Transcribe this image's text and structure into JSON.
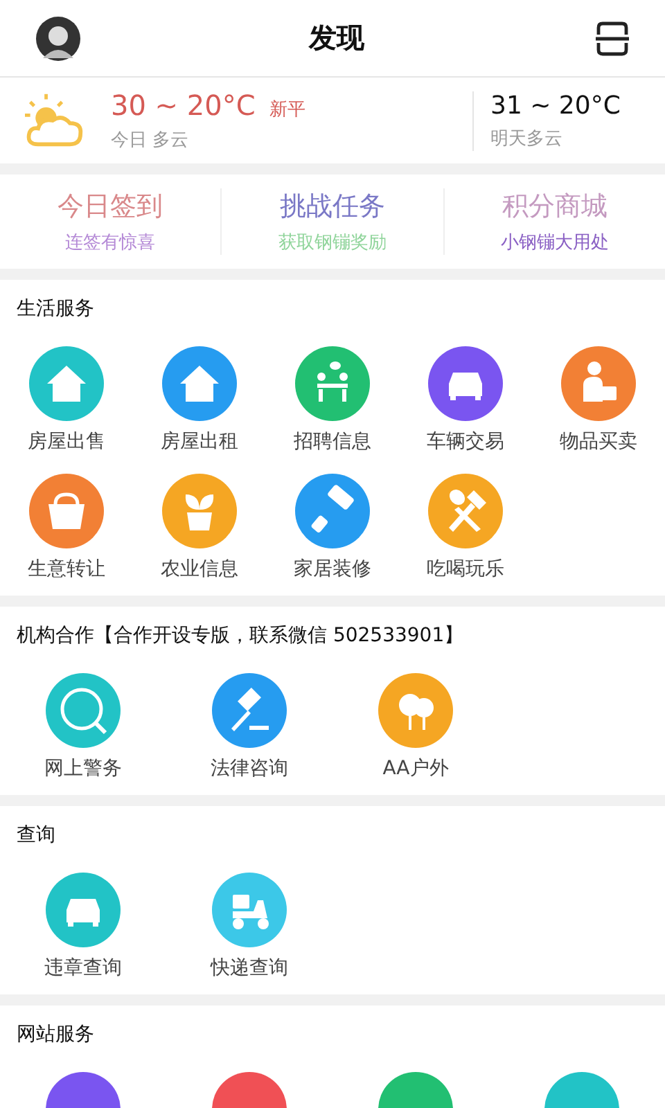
{
  "header": {
    "title": "发现"
  },
  "weather": {
    "today": {
      "temp": "30 ~ 20°C",
      "city": "新平",
      "desc": "今日 多云"
    },
    "tomorrow": {
      "temp": "31 ~ 20°C",
      "desc": "明天多云"
    }
  },
  "quick_links": [
    {
      "title": "今日签到",
      "color": "#d9888a",
      "subtitle": {
        "text": "连签有惊喜",
        "color": "#b489d6"
      }
    },
    {
      "title": "挑战任务",
      "color": "#7a78c6",
      "subtitle": {
        "text": "获取钢镚奖励",
        "color": "#8fd49a"
      }
    },
    {
      "title": "积分商城",
      "color": "#c49ac0",
      "subtitle": {
        "text": "小钢镚大用处",
        "color": "#8a60c4"
      }
    }
  ],
  "sections": [
    {
      "title": "生活服务",
      "items": [
        {
          "label": "房屋出售",
          "color": "#22c3c6"
        },
        {
          "label": "房屋出租",
          "color": "#269cf0"
        },
        {
          "label": "招聘信息",
          "color": "#22bf72"
        },
        {
          "label": "车辆交易",
          "color": "#7a55f0"
        },
        {
          "label": "物品买卖",
          "color": "#f28035"
        },
        {
          "label": "生意转让",
          "color": "#f28035"
        },
        {
          "label": "农业信息",
          "color": "#f5a623"
        },
        {
          "label": "家居装修",
          "color": "#269cf0"
        },
        {
          "label": "吃喝玩乐",
          "color": "#f5a623"
        }
      ]
    },
    {
      "title": "机构合作【合作开设专版，联系微信 502533901】",
      "items": [
        {
          "label": "网上警务",
          "color": "#22c3c6"
        },
        {
          "label": "法律咨询",
          "color": "#269cf0"
        },
        {
          "label": "AA户外",
          "color": "#f5a623"
        }
      ]
    },
    {
      "title": "查询",
      "items": [
        {
          "label": "违章查询",
          "color": "#22c3c6"
        },
        {
          "label": "快递查询",
          "color": "#3cc8e8"
        }
      ]
    },
    {
      "title": "网站服务",
      "items": [
        {
          "color": "#7a55f0"
        },
        {
          "color": "#f05055"
        },
        {
          "color": "#22bf72"
        },
        {
          "color": "#22c3c6"
        }
      ]
    }
  ]
}
